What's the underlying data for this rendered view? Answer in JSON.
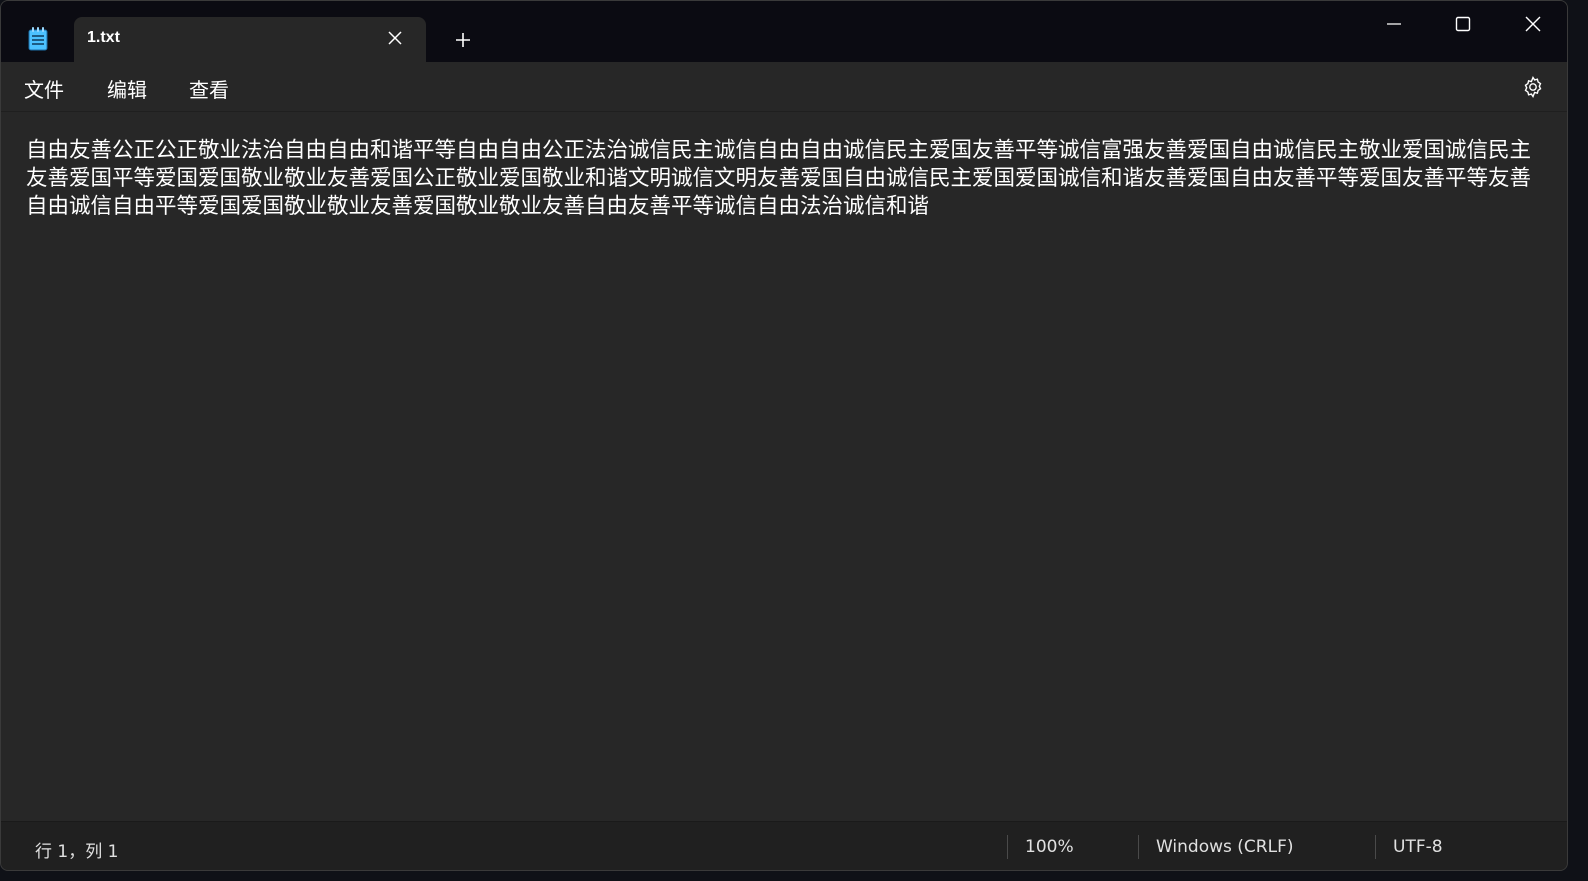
{
  "tab": {
    "title": "1.txt"
  },
  "menu": {
    "file": "文件",
    "edit": "编辑",
    "view": "查看"
  },
  "editor": {
    "content": "自由友善公正公正敬业法治自由自由和谐平等自由自由公正法治诚信民主诚信自由自由诚信民主爱国友善平等诚信富强友善爱国自由诚信民主敬业爱国诚信民主友善爱国平等爱国爱国敬业敬业友善爱国公正敬业爱国敬业和谐文明诚信文明友善爱国自由诚信民主爱国爱国诚信和谐友善爱国自由友善平等爱国友善平等友善自由诚信自由平等爱国爱国敬业敬业友善爱国敬业敬业友善自由友善平等诚信自由法治诚信和谐"
  },
  "status": {
    "position": "行 1，列 1",
    "zoom": "100%",
    "line_ending": "Windows (CRLF)",
    "encoding": "UTF-8"
  },
  "icons": {
    "app": "notepad-icon",
    "close_tab": "close-icon",
    "new_tab": "plus-icon",
    "minimize": "minimize-icon",
    "maximize": "maximize-icon",
    "close_window": "close-icon",
    "settings": "gear-icon"
  },
  "colors": {
    "titlebar": "#0b0b12",
    "editor_bg": "#272727",
    "statusbar": "#202020",
    "text": "#ffffff",
    "notepad_icon": "#4cc2ff"
  }
}
